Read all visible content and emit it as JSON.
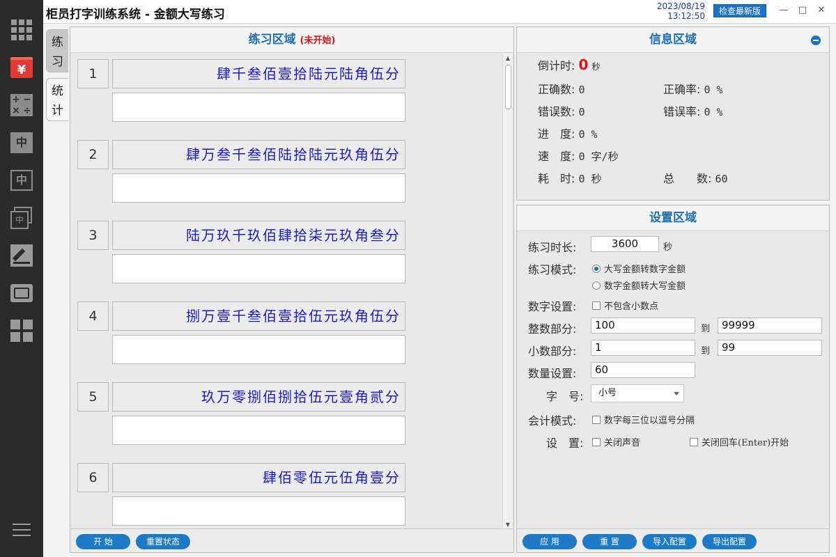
{
  "window": {
    "title": "柜员打字训练系统 - 金额大写练习",
    "date": "2023/08/19",
    "time": "13:12:50",
    "update_label": "检查最新版"
  },
  "sidebar_icons": [
    "grid-menu-icon",
    "yuan-icon",
    "calculator-icon",
    "chinese-char-filled-icon",
    "chinese-char-outline-icon",
    "chinese-char-stack-icon",
    "edit-icon",
    "cash-icon",
    "apps-grid-icon",
    "hamburger-menu-icon"
  ],
  "tabs": [
    {
      "label": "练习",
      "active": true
    },
    {
      "label": "统计",
      "active": false
    }
  ],
  "practice": {
    "title": "练习区域",
    "status": "(未开始)",
    "items": [
      {
        "num": "1",
        "text": "肆千叁佰壹拾陆元陆角伍分",
        "answer": ""
      },
      {
        "num": "2",
        "text": "肆万叁千叁佰陆拾陆元玖角伍分",
        "answer": ""
      },
      {
        "num": "3",
        "text": "陆万玖千玖佰肆拾柒元玖角叁分",
        "answer": ""
      },
      {
        "num": "4",
        "text": "捌万壹千叁佰壹拾伍元玖角伍分",
        "answer": ""
      },
      {
        "num": "5",
        "text": "玖万零捌佰捌拾伍元壹角贰分",
        "answer": ""
      },
      {
        "num": "6",
        "text": "肆佰零伍元伍角壹分",
        "answer": ""
      }
    ],
    "buttons": {
      "start": "开 始",
      "reset_status": "重置状态"
    }
  },
  "info": {
    "title": "信息区域",
    "countdown_label": "倒计时:",
    "countdown_value": "0",
    "countdown_unit": "秒",
    "correct_label": "正确数:",
    "correct_value": "0",
    "correct_rate_label": "正确率:",
    "correct_rate_value": "0 %",
    "error_label": "错误数:",
    "error_value": "0",
    "error_rate_label": "错误率:",
    "error_rate_value": "0 %",
    "progress_label": "进　度:",
    "progress_value": "0 %",
    "speed_label": "速　度:",
    "speed_value": "0 字/秒",
    "elapsed_label": "耗　时:",
    "elapsed_value": "0 秒",
    "total_label": "总　　数:",
    "total_value": "60"
  },
  "settings": {
    "title": "设置区域",
    "duration_label": "练习时长:",
    "duration_value": "3600",
    "duration_unit": "秒",
    "mode_label": "练习模式:",
    "mode_option_1": "大写金额转数字金额",
    "mode_option_2": "数字金额转大写金额",
    "mode_selected": 1,
    "number_label": "数字设置:",
    "no_decimal_label": "不包含小数点",
    "integer_label": "整数部分:",
    "integer_from": "100",
    "integer_to": "99999",
    "to_label": "到",
    "decimal_label": "小数部分:",
    "decimal_from": "1",
    "decimal_to": "99",
    "quantity_label": "数量设置:",
    "quantity_value": "60",
    "font_label": "字　号:",
    "font_value": "小号",
    "accounting_label": "会计模式:",
    "accounting_option": "数字每三位以逗号分隔",
    "misc_label": "设　置:",
    "mute_option": "关闭声音",
    "enter_option": "关闭回车(Enter)开始",
    "buttons": {
      "apply": "应 用",
      "reset": "重 置",
      "import": "导入配置",
      "export": "导出配置"
    }
  },
  "colors": {
    "accent": "#1d6fb0",
    "sidebar": "#2b2b2b",
    "alert": "#e01010",
    "practice_text": "#1a1acc"
  }
}
